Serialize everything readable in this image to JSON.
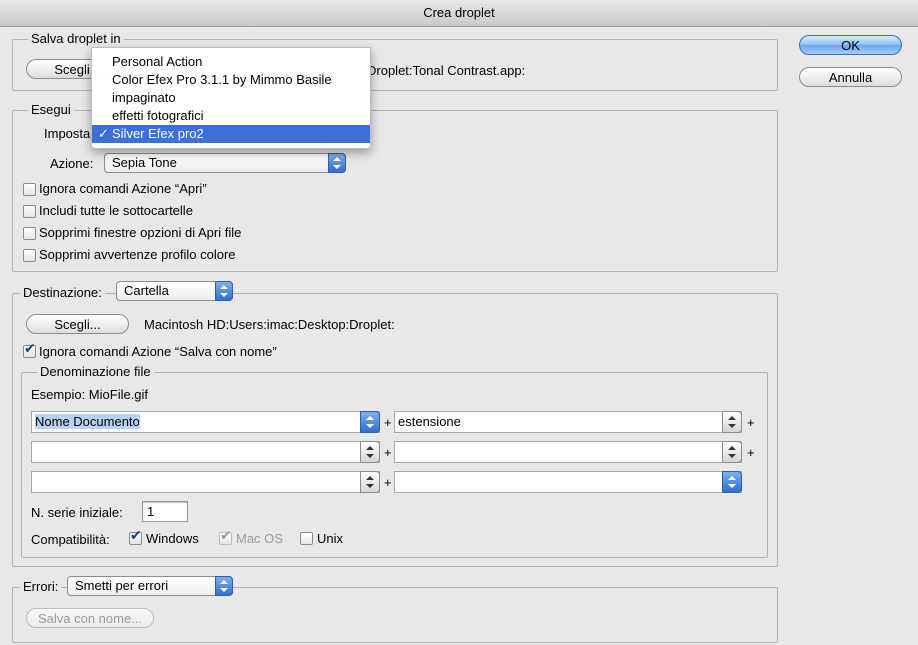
{
  "window": {
    "title": "Crea droplet"
  },
  "buttons": {
    "ok": "OK",
    "cancel": "Annulla"
  },
  "save_in": {
    "legend": "Salva droplet in",
    "choose_button": "Scegli...",
    "path": "Droplet:Tonal Contrast.app:"
  },
  "play": {
    "legend": "Esegui",
    "set_label": "Imposta",
    "action_label": "Azione:",
    "action_value": "Sepia Tone",
    "checkboxes": [
      {
        "label": "Ignora comandi Azione “Apri”",
        "checked": false
      },
      {
        "label": "Includi tutte le sottocartelle",
        "checked": false
      },
      {
        "label": "Sopprimi finestre opzioni di Apri file",
        "checked": false
      },
      {
        "label": "Sopprimi avvertenze profilo colore",
        "checked": false
      }
    ]
  },
  "set_menu": {
    "items": [
      {
        "label": "Personal Action",
        "selected": false
      },
      {
        "label": "Color Efex Pro 3.1.1 by Mimmo Basile",
        "selected": false
      },
      {
        "label": "impaginato",
        "selected": false
      },
      {
        "label": "effetti fotografici",
        "selected": false
      },
      {
        "label": "Silver Efex pro2",
        "selected": true
      }
    ],
    "checkmark": "✓"
  },
  "destination": {
    "label": "Destinazione:",
    "value": "Cartella",
    "choose_button": "Scegli...",
    "path": "Macintosh HD:Users:imac:Desktop:Droplet:",
    "override_label": "Ignora comandi Azione “Salva con nome”",
    "override_checked": true
  },
  "naming": {
    "legend": "Denominazione file",
    "example": "Esempio: MioFile.gif",
    "rows": [
      {
        "left": "Nome Documento",
        "right": "estensione"
      },
      {
        "left": "",
        "right": ""
      },
      {
        "left": "",
        "right": ""
      }
    ],
    "plus": "+",
    "serial_label": "N. serie iniziale:",
    "serial_value": "1",
    "compat_label": "Compatibilità:",
    "compat": [
      {
        "label": "Windows",
        "checked": true,
        "enabled": true
      },
      {
        "label": "Mac OS",
        "checked": true,
        "enabled": false
      },
      {
        "label": "Unix",
        "checked": false,
        "enabled": true
      }
    ]
  },
  "errors": {
    "label": "Errori:",
    "value": "Smetti per errori",
    "save_as_button": "Salva con nome..."
  }
}
